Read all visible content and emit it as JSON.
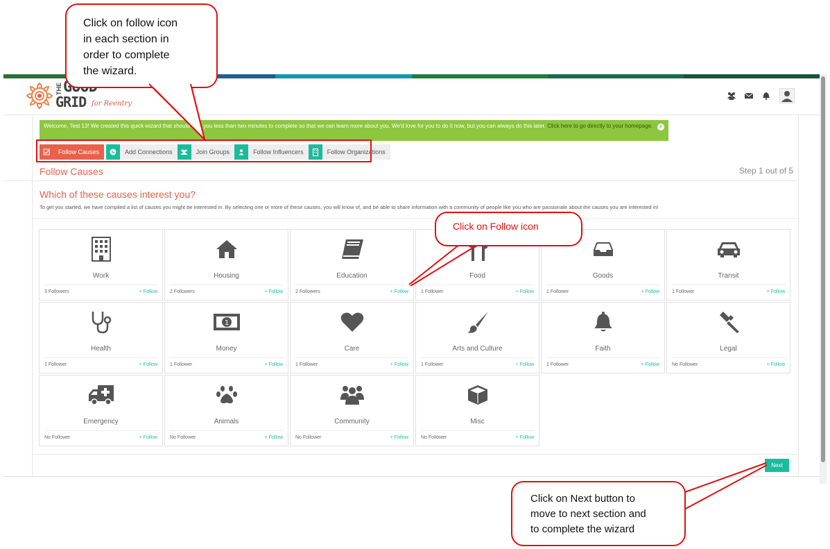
{
  "app": {
    "logo_the": "THE",
    "logo_good": "GOOD",
    "logo_grid": "GRID",
    "logo_sub": "for Reentry",
    "strip_colors": [
      "#2b8a3e",
      "#1f5f8b",
      "#169bb8",
      "#1c7a3c",
      "#1d6e4f",
      "#155e3c"
    ]
  },
  "header_icons": [
    "group-icon",
    "mail-icon",
    "bell-icon",
    "avatar"
  ],
  "welcome": {
    "text": "Welcome, Test 13! We created this quick wizard that should take you less than two minutes to complete so that we can learn more about you. We'd love for you to do it now, but you can always do this later.",
    "link": "Click here to go directly to your homepage."
  },
  "tabs": [
    {
      "label": "Follow Causes",
      "icon": "check-icon",
      "active": true
    },
    {
      "label": "Add Connections",
      "icon": "globe-icon",
      "active": false
    },
    {
      "label": "Join Groups",
      "icon": "group-icon",
      "active": false
    },
    {
      "label": "Follow Influencers",
      "icon": "user-icon",
      "active": false
    },
    {
      "label": "Follow Organizations",
      "icon": "building-icon",
      "active": false
    }
  ],
  "section": {
    "title": "Follow Causes",
    "step": "Step 1 out of 5",
    "question": "Which of these causes interest you?",
    "description": "To get you started, we have compiled a list of causes you might be interested in. By selecting one or more of these causes, you will know of, and be able to share information with a community of people like you who are passionate about the causes you are interested in!"
  },
  "causes": [
    {
      "name": "Work",
      "followers": "3 Followers",
      "icon": "building-icon"
    },
    {
      "name": "Housing",
      "followers": "2 Followers",
      "icon": "house-icon"
    },
    {
      "name": "Education",
      "followers": "2 Followers",
      "icon": "book-icon"
    },
    {
      "name": "Food",
      "followers": "1 Follower",
      "icon": "utensils-icon"
    },
    {
      "name": "Goods",
      "followers": "1 Follower",
      "icon": "inbox-icon"
    },
    {
      "name": "Transit",
      "followers": "1 Follower",
      "icon": "car-icon"
    },
    {
      "name": "Health",
      "followers": "1 Follower",
      "icon": "stethoscope-icon"
    },
    {
      "name": "Money",
      "followers": "1 Follower",
      "icon": "money-icon"
    },
    {
      "name": "Care",
      "followers": "1 Follower",
      "icon": "heart-icon"
    },
    {
      "name": "Arts and Culture",
      "followers": "1 Follower",
      "icon": "paintbrush-icon"
    },
    {
      "name": "Faith",
      "followers": "1 Follower",
      "icon": "bell-icon"
    },
    {
      "name": "Legal",
      "followers": "No Follower",
      "icon": "gavel-icon"
    },
    {
      "name": "Emergency",
      "followers": "No Follower",
      "icon": "ambulance-icon"
    },
    {
      "name": "Animals",
      "followers": "No Follower",
      "icon": "paw-icon"
    },
    {
      "name": "Community",
      "followers": "No Follower",
      "icon": "group-icon"
    },
    {
      "name": "Misc",
      "followers": "No Follower",
      "icon": "cube-icon"
    }
  ],
  "follow_label": "+ Follow",
  "next_label": "Next",
  "annotations": {
    "top": "Click on follow icon\nin each section in\norder to complete\nthe wizard.",
    "middle": "Click on Follow icon",
    "bottom": "Click on Next button to\nmove to next section and\nto complete the wizard"
  },
  "colors": {
    "accent": "#1abc9c",
    "brand": "#e9604b",
    "welcome_bg": "#8dc63f",
    "annotation": "#e01010"
  }
}
